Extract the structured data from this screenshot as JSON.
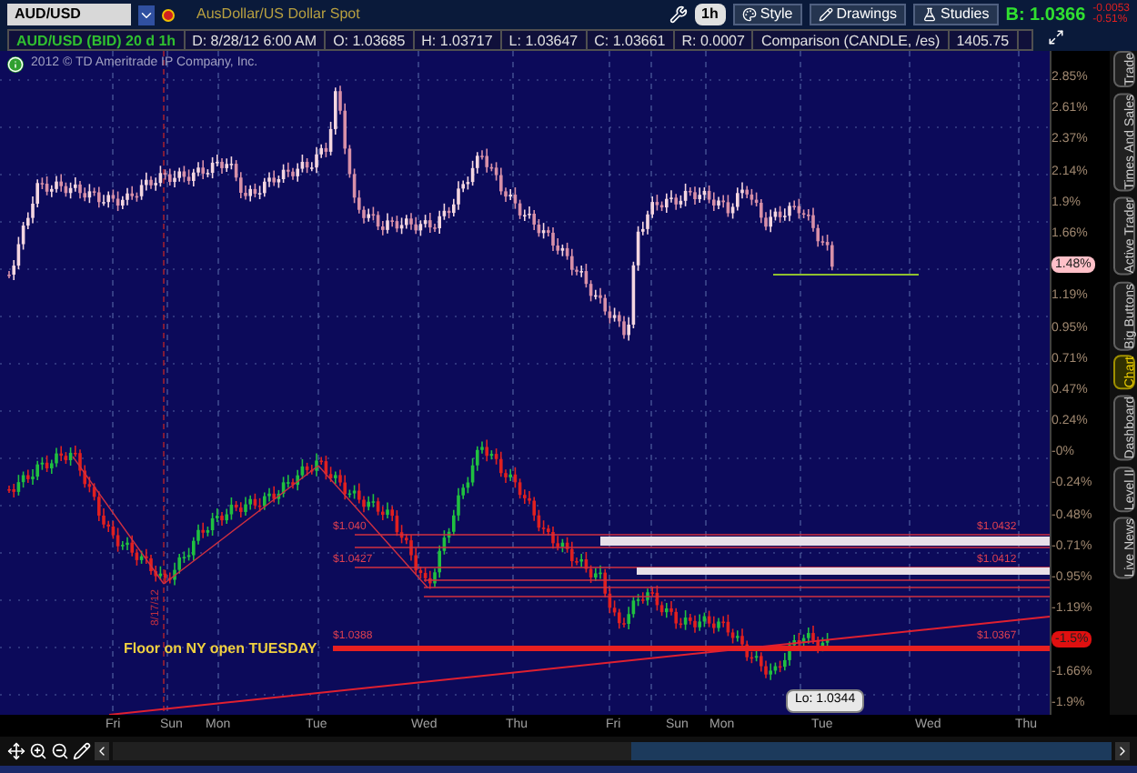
{
  "toolbar": {
    "symbol": "AUD/USD",
    "description": "AusDollar/US Dollar Spot",
    "interval": "1h",
    "buttons": [
      {
        "label": "Style",
        "kind": "style"
      },
      {
        "label": "Drawings",
        "kind": "drawings"
      },
      {
        "label": "Studies",
        "kind": "studies"
      }
    ],
    "bid": "B: 1.0366",
    "change": [
      "-0.0053",
      "-0.51%"
    ]
  },
  "info_bar": {
    "title": "AUD/USD (BID) 20 d 1h",
    "cells": [
      "D: 8/28/12 6:00 AM",
      "O: 1.03685",
      "H: 1.03717",
      "L: 1.03647",
      "C: 1.03661",
      "R: 0.0007",
      "Comparison (CANDLE, /es)",
      "1405.75"
    ]
  },
  "copyright": "2012 © TD Ameritrade IP Company, Inc.",
  "annotations": [
    {
      "text": "Floor on NY open TUESDAY",
      "kind": "note"
    },
    {
      "text": "$1.040",
      "kind": "price"
    },
    {
      "text": "$1.0427",
      "kind": "price"
    },
    {
      "text": "$1.0388",
      "kind": "price"
    },
    {
      "text": "$1.0432",
      "kind": "price"
    },
    {
      "text": "$1.0412",
      "kind": "price"
    },
    {
      "text": "$1.0367",
      "kind": "price"
    },
    {
      "text": "8/17/12",
      "kind": "date"
    },
    {
      "text": "Lo: 1.0344",
      "kind": "low"
    }
  ],
  "right_axis": [
    {
      "text": "2.85%",
      "kind": "tick"
    },
    {
      "text": "2.61%",
      "kind": "tick"
    },
    {
      "text": "2.37%",
      "kind": "tick"
    },
    {
      "text": "2.14%",
      "kind": "tick"
    },
    {
      "text": "1.9%",
      "kind": "tick"
    },
    {
      "text": "1.66%",
      "kind": "tick"
    },
    {
      "text": "1.48%",
      "kind": "badge",
      "color": "#ffc0c8"
    },
    {
      "text": "1.19%",
      "kind": "tick"
    },
    {
      "text": "0.95%",
      "kind": "tick"
    },
    {
      "text": "0.71%",
      "kind": "tick"
    },
    {
      "text": "0.47%",
      "kind": "tick"
    },
    {
      "text": "0.24%",
      "kind": "tick"
    },
    {
      "text": "-0%",
      "kind": "tick"
    },
    {
      "text": "-0.24%",
      "kind": "tick"
    },
    {
      "text": "-0.48%",
      "kind": "tick"
    },
    {
      "text": "-0.71%",
      "kind": "tick"
    },
    {
      "text": "-0.95%",
      "kind": "tick"
    },
    {
      "text": "-1.19%",
      "kind": "tick"
    },
    {
      "text": "-1.5%",
      "kind": "badge",
      "color": "#e01010"
    },
    {
      "text": "-1.66%",
      "kind": "tick"
    },
    {
      "text": "-1.9%",
      "kind": "tick"
    }
  ],
  "dates": [
    "Fri",
    "Sun",
    "Mon",
    "Tue",
    "Wed",
    "Thu",
    "Fri",
    "Sun",
    "Mon",
    "Tue",
    "Wed",
    "Thu"
  ],
  "side_tabs": [
    {
      "label": "Trade",
      "selected": false
    },
    {
      "label": "Times And Sales",
      "selected": false
    },
    {
      "label": "Active Trader",
      "selected": false
    },
    {
      "label": "Big Buttons",
      "selected": false
    },
    {
      "label": "Chart",
      "selected": true
    },
    {
      "label": "Dashboard",
      "selected": false
    },
    {
      "label": "Level II",
      "selected": false
    },
    {
      "label": "Live News",
      "selected": false
    }
  ]
}
